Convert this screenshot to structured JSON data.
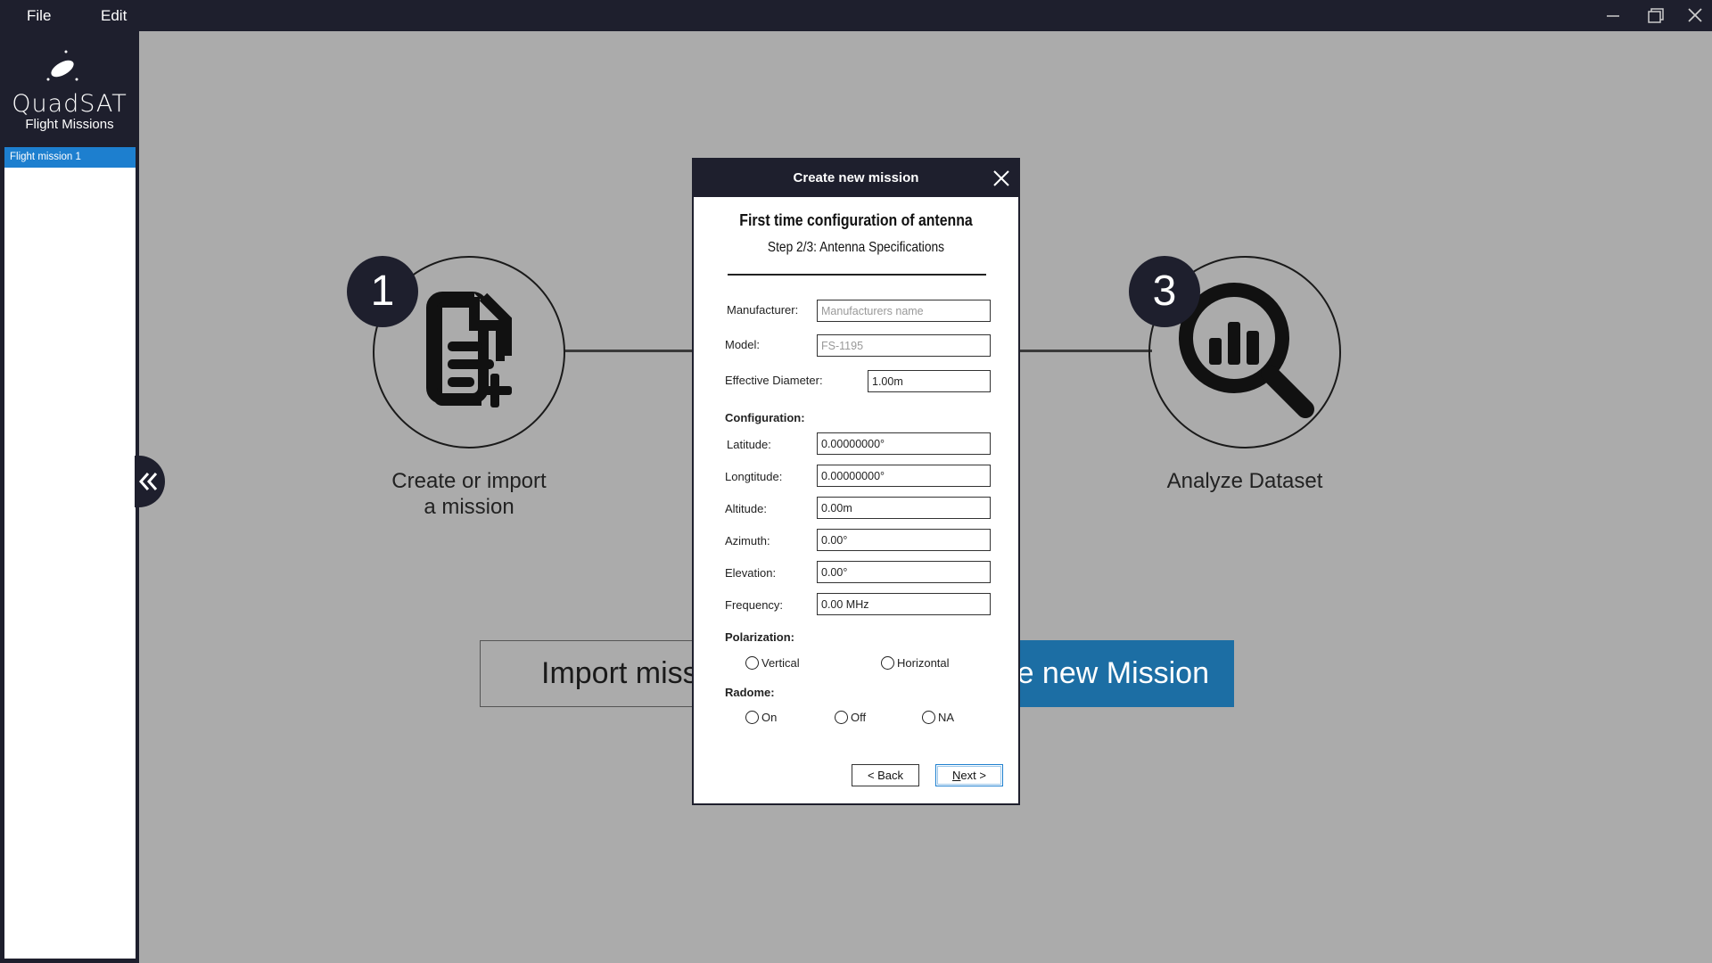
{
  "menu": {
    "file": "File",
    "edit": "Edit"
  },
  "brand": {
    "logo_text": "QuadSAT"
  },
  "sidebar": {
    "heading": "Flight Missions",
    "missions": [
      {
        "label": "Flight mission 1",
        "selected": true
      }
    ]
  },
  "steps": [
    {
      "number": "1",
      "label_line1": "Create or import",
      "label_line2": "a mission",
      "icon": "file-plus-icon"
    },
    {
      "number": "3",
      "label_line1": "Analyze Dataset",
      "label_line2": "",
      "icon": "search-chart-icon"
    }
  ],
  "main": {
    "import_button": "Import missi",
    "create_button": "te new Mission"
  },
  "dialog": {
    "header": "Create new mission",
    "title": "First time configuration of antenna",
    "subtitle": "Step 2/3: Antenna Specifications",
    "fields": {
      "manufacturer": {
        "label": "Manufacturer:",
        "value": "",
        "placeholder": "Manufacturers name"
      },
      "model": {
        "label": "Model:",
        "value": "FS-1195"
      },
      "diameter": {
        "label": "Effective Diameter:",
        "value": "1.00m"
      }
    },
    "configuration": {
      "heading": "Configuration:",
      "latitude": {
        "label": "Latitude:",
        "value": "0.00000000°"
      },
      "longitude": {
        "label": "Longtitude:",
        "value": "0.00000000°"
      },
      "altitude": {
        "label": "Altitude:",
        "value": "0.00m"
      },
      "azimuth": {
        "label": "Azimuth:",
        "value": "0.00°"
      },
      "elevation": {
        "label": "Elevation:",
        "value": "0.00°"
      },
      "frequency": {
        "label": "Frequency:",
        "value": "0.00 MHz"
      }
    },
    "polarization": {
      "heading": "Polarization:",
      "options": [
        "Vertical",
        "Horizontal"
      ]
    },
    "radome": {
      "heading": "Radome:",
      "options": [
        "On",
        "Off",
        "NA"
      ]
    },
    "back_button": "< Back",
    "next_button_underlined": "N",
    "next_button_rest": "ext >"
  },
  "colors": {
    "titlebar": "#1e1f2d",
    "accent": "#1d7fcf",
    "create_button": "#1c6ea4",
    "background": "#ababab"
  }
}
